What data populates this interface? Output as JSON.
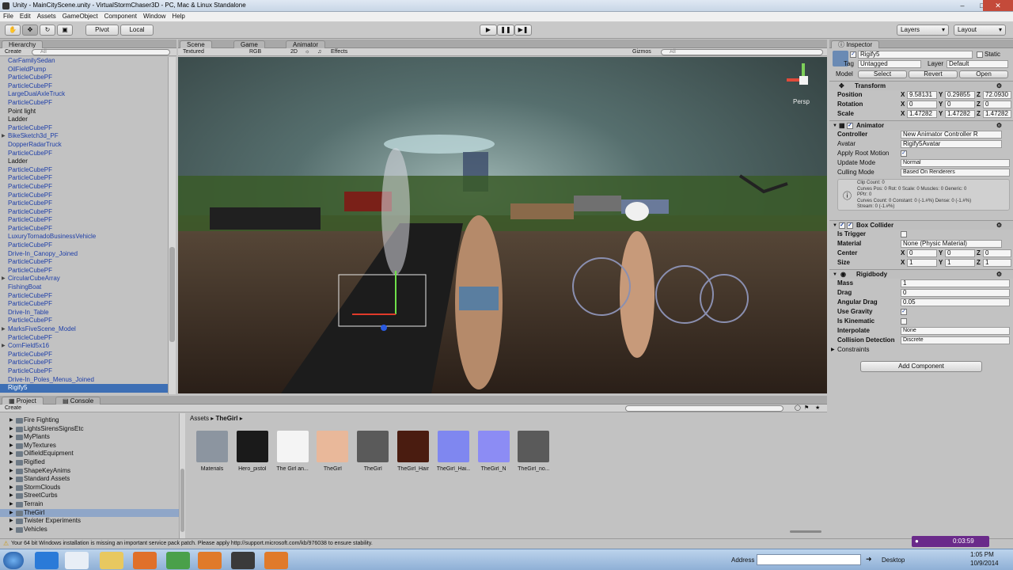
{
  "window": {
    "title": "Unity - MainCityScene.unity - VirtualStormChaser3D - PC, Mac & Linux Standalone"
  },
  "menu": [
    "File",
    "Edit",
    "Assets",
    "GameObject",
    "Component",
    "Window",
    "Help"
  ],
  "toolbar": {
    "pivot": "Pivot",
    "local": "Local",
    "play_icon": "play-icon",
    "pause_icon": "pause-icon",
    "step_icon": "step-icon",
    "layers": "Layers",
    "layout": "Layout"
  },
  "hierarchy": {
    "tab": "Hierarchy",
    "create": "Create",
    "search_placeholder": "All",
    "items": [
      {
        "label": "CarFamilySedan",
        "blue": true
      },
      {
        "label": "OilFieldPump",
        "blue": true
      },
      {
        "label": "ParticleCubePF",
        "blue": true
      },
      {
        "label": "ParticleCubePF",
        "blue": true
      },
      {
        "label": "LargeDualAxleTruck",
        "blue": true
      },
      {
        "label": "ParticleCubePF",
        "blue": true
      },
      {
        "label": "Point light",
        "blue": false
      },
      {
        "label": "Ladder",
        "blue": false
      },
      {
        "label": "ParticleCubePF",
        "blue": true
      },
      {
        "label": "BikeSketch3d_PF",
        "blue": true,
        "arrow": true
      },
      {
        "label": "DopperRadarTruck",
        "blue": true
      },
      {
        "label": "ParticleCubePF",
        "blue": true
      },
      {
        "label": "Ladder",
        "blue": false
      },
      {
        "label": "ParticleCubePF",
        "blue": true
      },
      {
        "label": "ParticleCubePF",
        "blue": true
      },
      {
        "label": "ParticleCubePF",
        "blue": true
      },
      {
        "label": "ParticleCubePF",
        "blue": true
      },
      {
        "label": "ParticleCubePF",
        "blue": true
      },
      {
        "label": "ParticleCubePF",
        "blue": true
      },
      {
        "label": "ParticleCubePF",
        "blue": true
      },
      {
        "label": "ParticleCubePF",
        "blue": true
      },
      {
        "label": "LuxuryTornadoBusinessVehicle",
        "blue": true
      },
      {
        "label": "ParticleCubePF",
        "blue": true
      },
      {
        "label": "Drive-In_Canopy_Joined",
        "blue": true
      },
      {
        "label": "ParticleCubePF",
        "blue": true
      },
      {
        "label": "ParticleCubePF",
        "blue": true
      },
      {
        "label": "CircularCubeArray",
        "blue": true,
        "arrow": true
      },
      {
        "label": "FishingBoat",
        "blue": true
      },
      {
        "label": "ParticleCubePF",
        "blue": true
      },
      {
        "label": "ParticleCubePF",
        "blue": true
      },
      {
        "label": "Drive-In_Table",
        "blue": true
      },
      {
        "label": "ParticleCubePF",
        "blue": true
      },
      {
        "label": "MarksFiveScene_Model",
        "blue": true,
        "arrow": true
      },
      {
        "label": "ParticleCubePF",
        "blue": true
      },
      {
        "label": "CornField5x16",
        "blue": true,
        "arrow": true
      },
      {
        "label": "ParticleCubePF",
        "blue": true
      },
      {
        "label": "ParticleCubePF",
        "blue": true
      },
      {
        "label": "ParticleCubePF",
        "blue": true
      },
      {
        "label": "Drive-In_Poles_Menus_Joined",
        "blue": true
      },
      {
        "label": "Rigify5",
        "blue": true,
        "selected": true
      }
    ]
  },
  "scene": {
    "tabs": [
      "Scene",
      "Game",
      "Animator"
    ],
    "shading": "Textured",
    "render_mode": "RGB",
    "mode_2d": "2D",
    "effects": "Effects",
    "gizmos": "Gizmos",
    "search_placeholder": "All",
    "persp": "Persp"
  },
  "inspector": {
    "tab": "Inspector",
    "object_name": "Rigify5",
    "static": "Static",
    "tag_label": "Tag",
    "tag": "Untagged",
    "layer_label": "Layer",
    "layer": "Default",
    "model_label": "Model",
    "select": "Select",
    "revert": "Revert",
    "open": "Open",
    "transform": {
      "title": "Transform",
      "position_label": "Position",
      "position": [
        "9.58131",
        "0.29855",
        "72.0930"
      ],
      "rotation_label": "Rotation",
      "rotation": [
        "0",
        "0",
        "0"
      ],
      "scale_label": "Scale",
      "scale": [
        "1.47282",
        "1.47282",
        "1.47282"
      ]
    },
    "axes": [
      "X",
      "Y",
      "Z"
    ],
    "animator": {
      "title": "Animator",
      "controller_label": "Controller",
      "controller": "New Animator Controller R",
      "avatar_label": "Avatar",
      "avatar": "Rigify5Avatar",
      "root_motion_label": "Apply Root Motion",
      "update_mode_label": "Update Mode",
      "update_mode": "Normal",
      "culling_label": "Culling Mode",
      "culling": "Based On Renderers",
      "info": [
        "Clip Count: 0",
        "Curves Pos: 0 Rot: 0 Scale: 0 Muscles: 0 Generic: 0",
        "PPtr: 0",
        "Curves Count: 0 Constant: 0 (-1.#%) Dense: 0 (-1.#%)",
        "Stream: 0 (-1.#%)"
      ]
    },
    "box_collider": {
      "title": "Box Collider",
      "trigger_label": "Is Trigger",
      "material_label": "Material",
      "material": "None (Physic Material)",
      "center_label": "Center",
      "center": [
        "0",
        "0",
        "0"
      ],
      "size_label": "Size",
      "size": [
        "1",
        "1",
        "1"
      ]
    },
    "rigidbody": {
      "title": "Rigidbody",
      "mass_label": "Mass",
      "mass": "1",
      "drag_label": "Drag",
      "drag": "0",
      "angular_label": "Angular Drag",
      "angular": "0.05",
      "gravity_label": "Use Gravity",
      "kinematic_label": "Is Kinematic",
      "interpolate_label": "Interpolate",
      "interpolate": "None",
      "collision_label": "Collision Detection",
      "collision": "Discrete",
      "constraints_label": "Constraints"
    },
    "add_component": "Add Component"
  },
  "project": {
    "tabs": [
      "Project",
      "Console"
    ],
    "create": "Create",
    "folders": [
      "Fire Fighting",
      "LightsSirensSignsEtc",
      "MyPlants",
      "MyTextures",
      "OilfieldEquipment",
      "Rigified",
      "ShapeKeyAnims",
      "Standard Assets",
      "StormClouds",
      "StreetCurbs",
      "Terrain",
      "TheGirl",
      "Twister Experiments",
      "Vehicles"
    ],
    "selected_folder": "TheGirl",
    "breadcrumb": [
      "Assets",
      "TheGirl"
    ],
    "assets": [
      {
        "name": "Materials",
        "color": "#8c95a0"
      },
      {
        "name": "Hero_pistol",
        "color": "#1a1a1a"
      },
      {
        "name": "The Girl an...",
        "color": "#f4f4f4"
      },
      {
        "name": "TheGirl",
        "color": "#e9b89a"
      },
      {
        "name": "TheGirl",
        "color": "#5a5a5a"
      },
      {
        "name": "TheGirl_Hair",
        "color": "#4a1c10"
      },
      {
        "name": "TheGirl_Hai...",
        "color": "#7f87f0"
      },
      {
        "name": "TheGirl_N",
        "color": "#8c8cf4"
      },
      {
        "name": "TheGirl_no...",
        "color": "#5a5a5a"
      }
    ]
  },
  "status": "Your 64 bit Windows installation is missing an important service pack patch. Please apply http://support.microsoft.com/kb/976038 to ensure stability.",
  "taskbar": {
    "address_label": "Address",
    "desktop": "Desktop",
    "time": "1:05 PM",
    "date": "10/9/2014",
    "recording_time": "0:03:59"
  }
}
